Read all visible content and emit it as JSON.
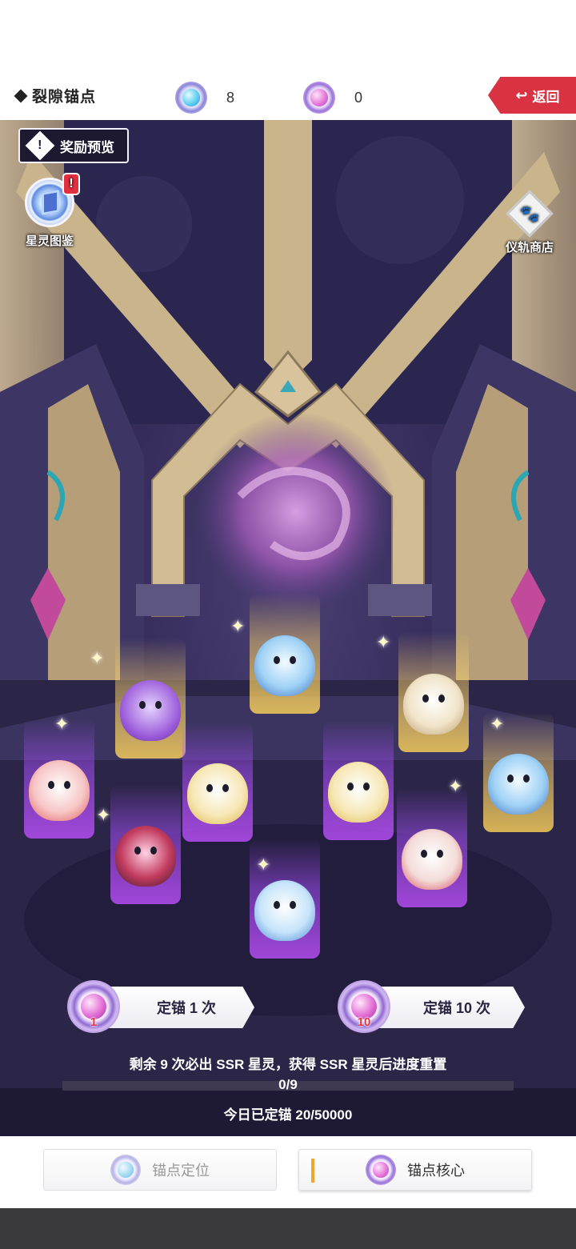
{
  "header": {
    "title": "裂隙锚点",
    "currency_blue": {
      "icon": "blue-anchor-gem-icon",
      "count": "8"
    },
    "currency_pink": {
      "icon": "pink-anchor-core-icon",
      "count": "0"
    },
    "back_label": "返回",
    "accent_color": "#d93343"
  },
  "scene": {
    "reward_preview_label": "奖励预览",
    "atlas_label": "星灵图鉴",
    "atlas_alert": "!",
    "shop_label": "仪轨商店",
    "spirits": [
      {
        "rarity": "gold",
        "name": "purple-knight-spirit"
      },
      {
        "rarity": "gold",
        "name": "ice-dragon-spirit"
      },
      {
        "rarity": "gold",
        "name": "crystal-beast-spirit"
      },
      {
        "rarity": "gold",
        "name": "ice-dragon-spirit-2"
      },
      {
        "rarity": "purple",
        "name": "pink-fairy-spirit"
      },
      {
        "rarity": "purple",
        "name": "blonde-fairy-spirit"
      },
      {
        "rarity": "purple",
        "name": "blonde-fairy-spirit-2"
      },
      {
        "rarity": "purple",
        "name": "red-demon-spirit"
      },
      {
        "rarity": "purple",
        "name": "blue-fairy-spirit"
      },
      {
        "rarity": "purple",
        "name": "cloud-sheep-spirit"
      }
    ]
  },
  "pull": {
    "single": {
      "label": "定锚 1 次",
      "cost": "1"
    },
    "ten": {
      "label": "定锚 10 次",
      "cost": "10"
    }
  },
  "pity": {
    "text": "剩余 9 次必出 SSR 星灵，获得 SSR 星灵后进度重置",
    "progress_text": "0/9",
    "progress_value": 0,
    "progress_max": 9
  },
  "daily": {
    "text": "今日已定锚 20/50000"
  },
  "tabs": [
    {
      "label": "锚点定位",
      "active": false
    },
    {
      "label": "锚点核心",
      "active": true
    }
  ]
}
